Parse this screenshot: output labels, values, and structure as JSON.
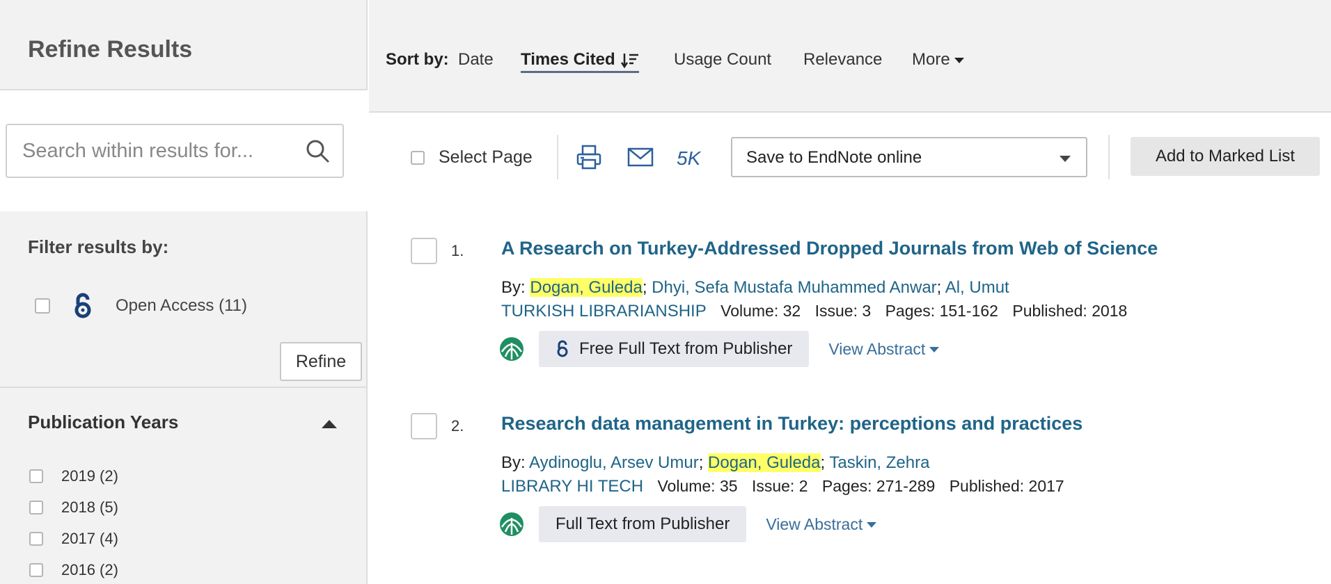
{
  "sidebar": {
    "title": "Refine Results",
    "search_placeholder": "Search within results for...",
    "filter_title": "Filter results by:",
    "open_access_label": "Open Access (11)",
    "refine_label": "Refine",
    "publication_years_title": "Publication Years",
    "years": [
      {
        "label": "2019 (2)"
      },
      {
        "label": "2018 (5)"
      },
      {
        "label": "2017 (4)"
      },
      {
        "label": "2016 (2)"
      }
    ]
  },
  "sort": {
    "label": "Sort by:",
    "options": [
      "Date",
      "Times Cited",
      "Usage Count",
      "Relevance",
      "More"
    ],
    "active": "Times Cited"
  },
  "toolbar": {
    "select_page": "Select Page",
    "count": "5K",
    "save_value": "Save to EndNote online",
    "add_marked": "Add to Marked List"
  },
  "records": [
    {
      "num": "1.",
      "title": "A Research on Turkey-Addressed Dropped Journals from Web of Science",
      "by": "By:",
      "authors": [
        "Dogan, Guleda",
        "Dhyi, Sefa Mustafa Muhammed Anwar",
        "Al, Umut"
      ],
      "journal": "TURKISH LIBRARIANSHIP",
      "volume_label": "Volume:",
      "volume": "32",
      "issue_label": "Issue:",
      "issue": "3",
      "pages_label": "Pages:",
      "pages": "151-162",
      "published_label": "Published:",
      "published": "2018",
      "fulltext": "Free Full Text from Publisher",
      "abstract": "View Abstract"
    },
    {
      "num": "2.",
      "title": "Research data management in Turkey: perceptions and practices",
      "by": "By:",
      "authors": [
        "Aydinoglu, Arsev Umur",
        "Dogan, Guleda",
        "Taskin, Zehra"
      ],
      "journal": "LIBRARY HI TECH",
      "volume_label": "Volume:",
      "volume": "35",
      "issue_label": "Issue:",
      "issue": "2",
      "pages_label": "Pages:",
      "pages": "271-289",
      "published_label": "Published:",
      "published": "2017",
      "fulltext": "Full Text from Publisher",
      "abstract": "View Abstract"
    }
  ],
  "colors": {
    "link": "#1f6488",
    "highlight": "#ffff66",
    "sidebar_bg": "#f2f2f2",
    "button_bg": "#e8e9ef"
  },
  "icons": [
    "search-icon",
    "open-access-icon",
    "caret-up-icon",
    "sort-desc-icon",
    "caret-down-icon",
    "print-icon",
    "email-icon",
    "publisher-globe-icon"
  ]
}
